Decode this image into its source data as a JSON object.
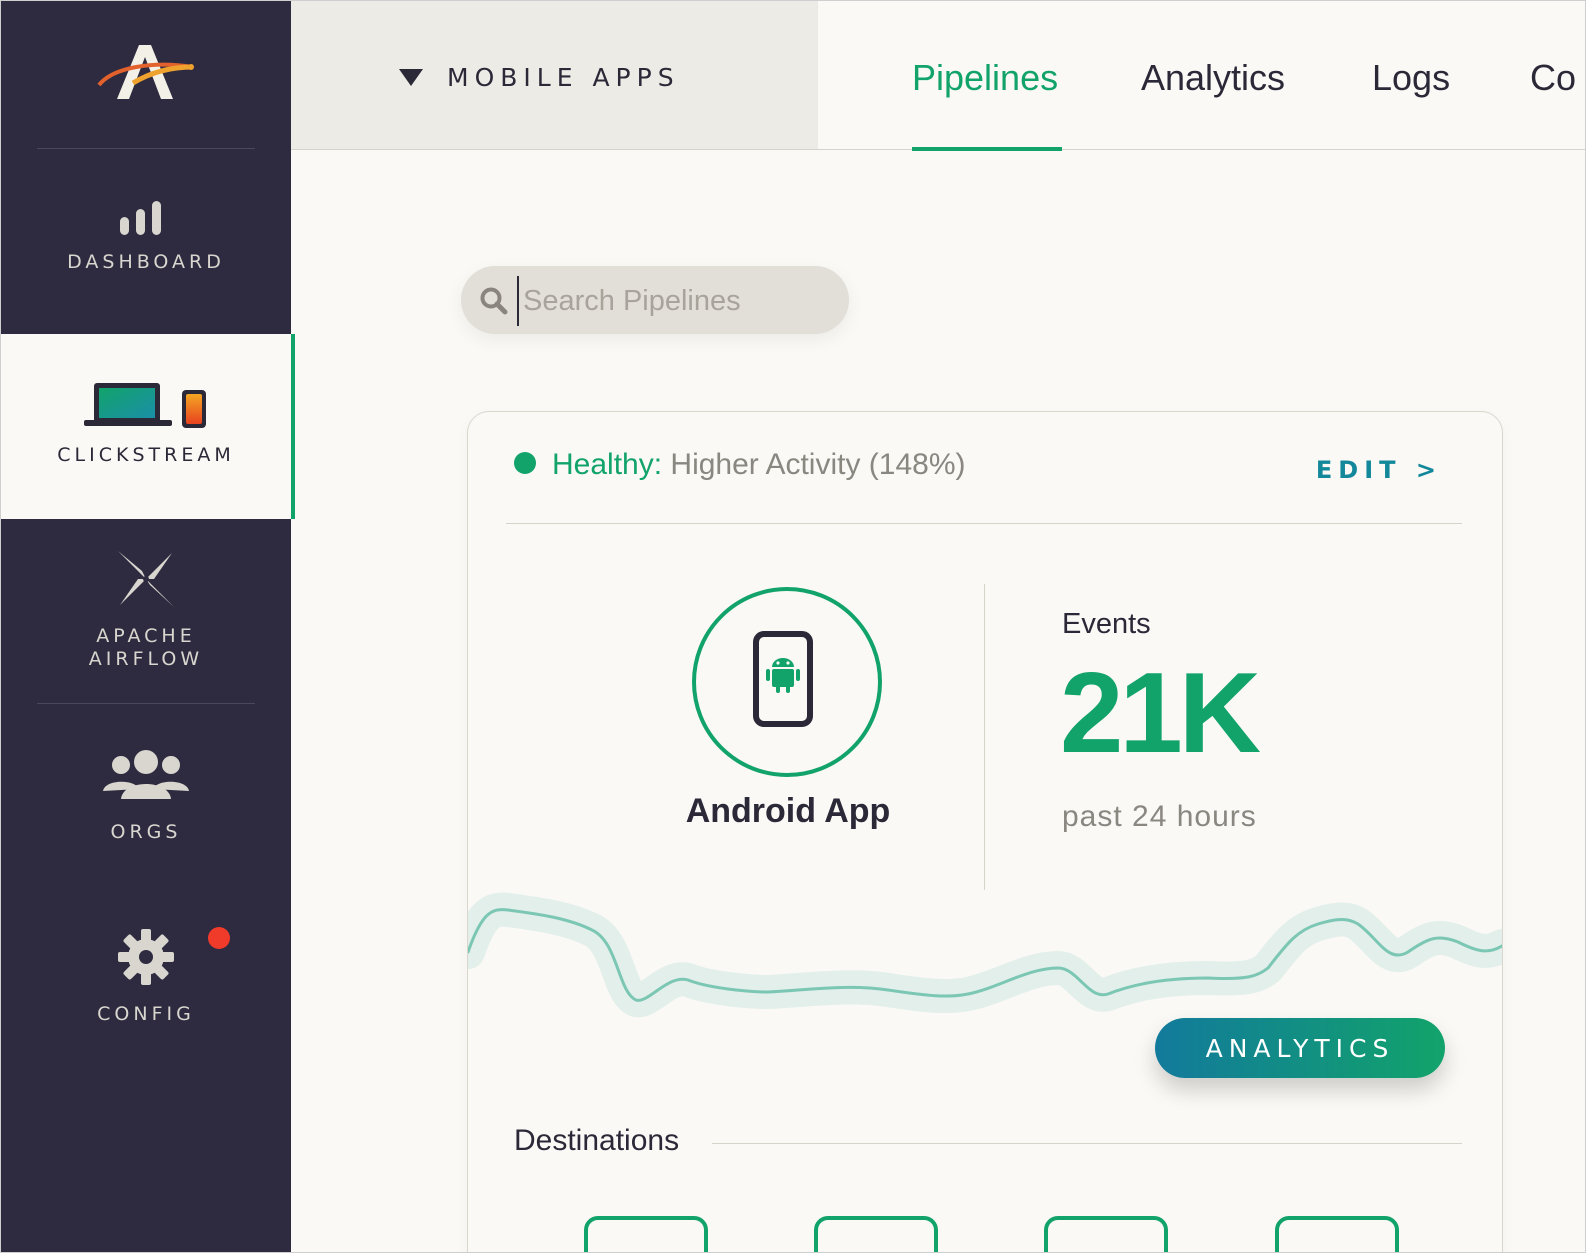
{
  "sidebar": {
    "items": [
      {
        "label": "DASHBOARD",
        "icon": "bar-chart-icon"
      },
      {
        "label": "CLICKSTREAM",
        "icon": "laptop-phone-icon"
      },
      {
        "label": "APACHE",
        "label2": "AIRFLOW",
        "icon": "pinwheel-icon"
      },
      {
        "label": "ORGS",
        "icon": "people-icon"
      },
      {
        "label": "CONFIG",
        "icon": "gear-icon"
      }
    ],
    "active": "CLICKSTREAM"
  },
  "header": {
    "app_selector": "MOBILE APPS",
    "tabs": [
      {
        "label": "Pipelines",
        "active": true
      },
      {
        "label": "Analytics",
        "active": false
      },
      {
        "label": "Logs",
        "active": false
      },
      {
        "label": "Co",
        "active": false
      }
    ]
  },
  "search": {
    "placeholder": "Search Pipelines",
    "value": ""
  },
  "pipeline": {
    "status_key": "Healthy:",
    "status_detail": "Higher Activity (148%)",
    "edit_label": "EDIT >",
    "source_name": "Android App",
    "events_label": "Events",
    "events_value": "21K",
    "events_period": "past 24 hours",
    "analytics_button": "ANALYTICS",
    "destinations_label": "Destinations",
    "destination_count": 4
  },
  "colors": {
    "sidebar_bg": "#2e2b40",
    "accent_green": "#12a36a",
    "accent_teal": "#12889a",
    "notification": "#f03a2a"
  }
}
